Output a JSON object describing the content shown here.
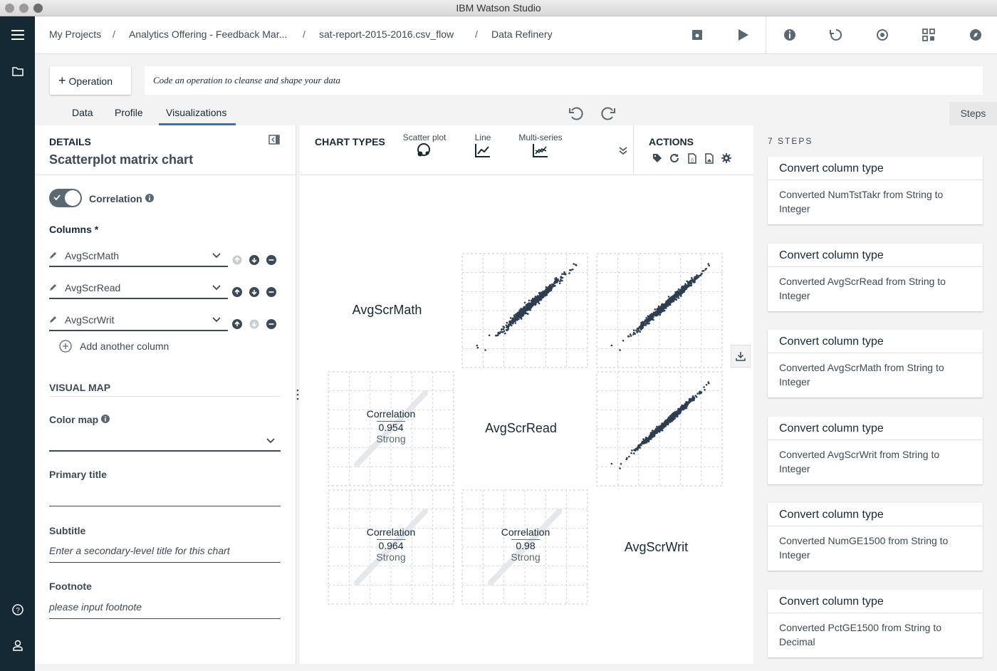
{
  "window": {
    "title": "IBM Watson Studio"
  },
  "breadcrumb": {
    "items": [
      "My Projects",
      "Analytics Offering - Feedback Mar...",
      "sat-report-2015-2016.csv_flow",
      "Data Refinery"
    ],
    "separator": "/"
  },
  "operation": {
    "button_label": "Operation",
    "input_placeholder": "Code an operation to cleanse and shape your data"
  },
  "tabs": [
    "Data",
    "Profile",
    "Visualizations"
  ],
  "active_tab": "Visualizations",
  "steps_tab_label": "Steps",
  "details": {
    "section_label": "DETAILS",
    "chart_name": "Scatterplot matrix chart",
    "correlation_label": "Correlation",
    "correlation_on": true,
    "columns_label": "Columns *",
    "columns": [
      "AvgScrMath",
      "AvgScrRead",
      "AvgScrWrit"
    ],
    "add_column_label": "Add another column",
    "visual_map_label": "VISUAL MAP",
    "color_map_label": "Color map",
    "color_map_value": "",
    "primary_title_label": "Primary title",
    "primary_title_value": "",
    "subtitle_label": "Subtitle",
    "subtitle_placeholder": "Enter a secondary-level title for this chart",
    "footnote_label": "Footnote",
    "footnote_placeholder": "please input footnote"
  },
  "chart_types": {
    "label": "CHART TYPES",
    "items": [
      "Scatter plot",
      "Line",
      "Multi-series"
    ]
  },
  "actions": {
    "label": "ACTIONS"
  },
  "matrix": {
    "variables": [
      "AvgScrMath",
      "AvgScrRead",
      "AvgScrWrit"
    ],
    "correlations": [
      {
        "label": "Correlation",
        "value": "0.954",
        "strength": "Strong"
      },
      {
        "label": "Correlation",
        "value": "0.964",
        "strength": "Strong"
      },
      {
        "label": "Correlation",
        "value": "0.98",
        "strength": "Strong"
      }
    ]
  },
  "chart_data": {
    "type": "scatter",
    "title": "",
    "variables": [
      "AvgScrMath",
      "AvgScrRead",
      "AvgScrWrit"
    ],
    "correlations": [
      {
        "x": "AvgScrMath",
        "y": "AvgScrRead",
        "r": 0.954,
        "strength": "Strong"
      },
      {
        "x": "AvgScrMath",
        "y": "AvgScrWrit",
        "r": 0.964,
        "strength": "Strong"
      },
      {
        "x": "AvgScrRead",
        "y": "AvgScrWrit",
        "r": 0.98,
        "strength": "Strong"
      }
    ]
  },
  "steps": {
    "count_label": "7 STEPS",
    "items": [
      {
        "title": "Convert column type",
        "description": "Converted NumTstTakr from String to Integer"
      },
      {
        "title": "Convert column type",
        "description": "Converted AvgScrRead from String to Integer"
      },
      {
        "title": "Convert column type",
        "description": "Converted AvgScrMath from String to Integer"
      },
      {
        "title": "Convert column type",
        "description": "Converted AvgScrWrit from String to Integer"
      },
      {
        "title": "Convert column type",
        "description": "Converted NumGE1500 from String to Integer"
      },
      {
        "title": "Convert column type",
        "description": "Converted PctGE1500 from String to Decimal"
      }
    ]
  },
  "colors": {
    "nav": "#152935",
    "accent": "#3d70b2",
    "scatter_point": "#2c3e50"
  }
}
